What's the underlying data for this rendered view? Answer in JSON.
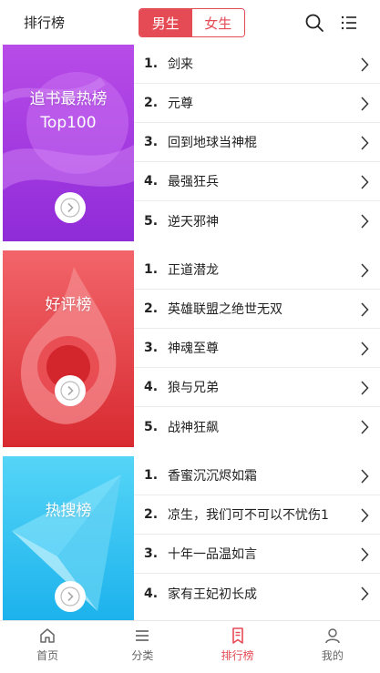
{
  "header": {
    "title": "排行榜",
    "tabs": [
      {
        "label": "男生",
        "active": true
      },
      {
        "label": "女生",
        "active": false
      }
    ]
  },
  "colors": {
    "accent": "#e44b54",
    "purple_top": "#b04be6",
    "purple_bottom": "#8a2ad6",
    "red_top": "#f25b62",
    "red_bottom": "#d6262e",
    "blue_top": "#4fd3f7",
    "blue_bottom": "#1bb1ec"
  },
  "sections": [
    {
      "banner_line1": "追书最热榜",
      "banner_line2": "Top100",
      "books": [
        {
          "rank": "1.",
          "title": "剑来"
        },
        {
          "rank": "2.",
          "title": "元尊"
        },
        {
          "rank": "3.",
          "title": "回到地球当神棍"
        },
        {
          "rank": "4.",
          "title": "最强狂兵"
        },
        {
          "rank": "5.",
          "title": "逆天邪神"
        }
      ]
    },
    {
      "banner_line1": "好评榜",
      "books": [
        {
          "rank": "1.",
          "title": "正道潜龙"
        },
        {
          "rank": "2.",
          "title": "英雄联盟之绝世无双"
        },
        {
          "rank": "3.",
          "title": "神魂至尊"
        },
        {
          "rank": "4.",
          "title": "狼与兄弟"
        },
        {
          "rank": "5.",
          "title": "战神狂飙"
        }
      ]
    },
    {
      "banner_line1": "热搜榜",
      "books": [
        {
          "rank": "1.",
          "title": "香蜜沉沉烬如霜"
        },
        {
          "rank": "2.",
          "title": "凉生，我们可不可以不忧伤1"
        },
        {
          "rank": "3.",
          "title": "十年一品温如言"
        },
        {
          "rank": "4.",
          "title": "家有王妃初长成"
        }
      ]
    }
  ],
  "bottom_nav": [
    {
      "label": "首页",
      "icon": "home-icon",
      "active": false
    },
    {
      "label": "分类",
      "icon": "category-icon",
      "active": false
    },
    {
      "label": "排行榜",
      "icon": "ranking-icon",
      "active": true
    },
    {
      "label": "我的",
      "icon": "profile-icon",
      "active": false
    }
  ]
}
